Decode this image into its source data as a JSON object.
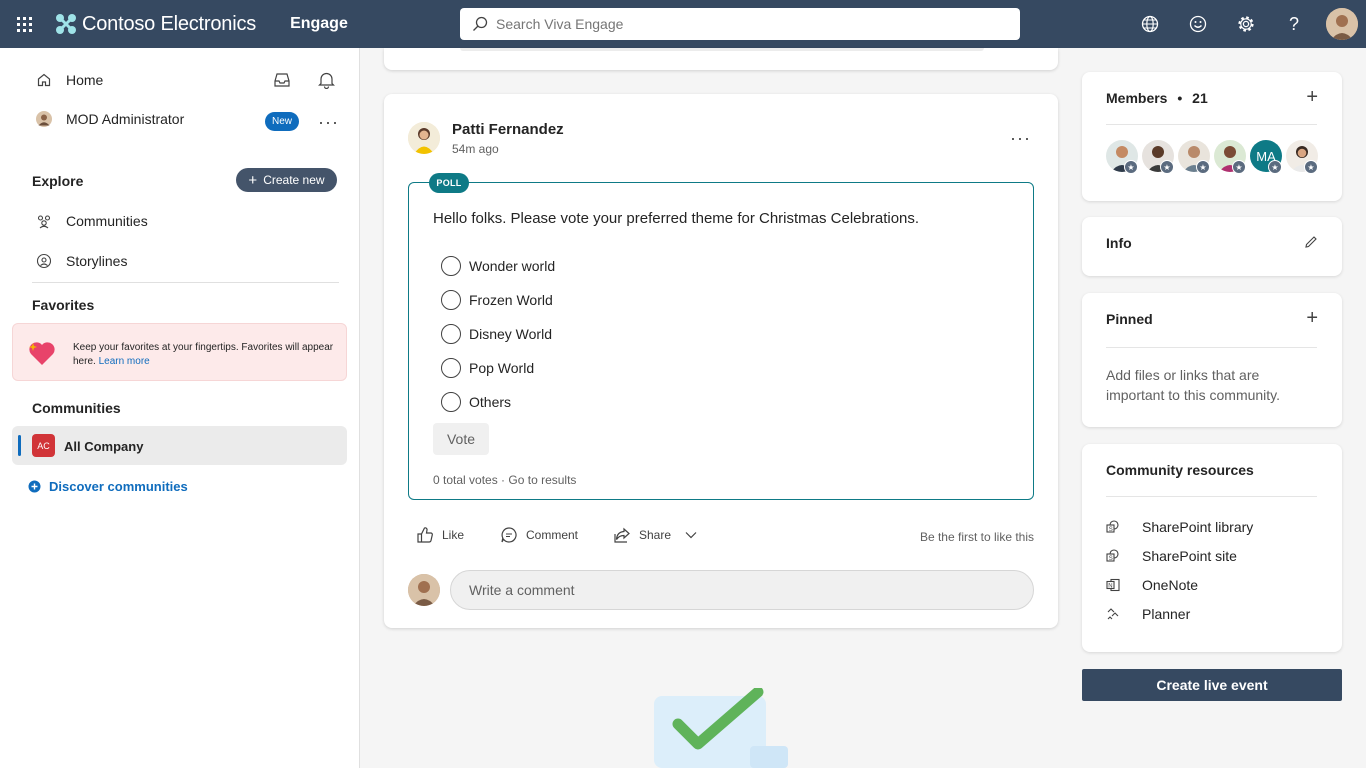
{
  "topbar": {
    "brand": "Contoso Electronics",
    "app": "Engage",
    "search_placeholder": "Search Viva Engage"
  },
  "leftnav": {
    "home": "Home",
    "user": "MOD Administrator",
    "new_badge": "New",
    "explore_title": "Explore",
    "create_new": "Create new",
    "communities": "Communities",
    "storylines": "Storylines",
    "favorites_title": "Favorites",
    "favorites_text": "Keep your favorites at your fingertips. Favorites will appear here.",
    "learn_more": "Learn more",
    "communities_title": "Communities",
    "community_initials": "AC",
    "community_name": "All Company",
    "discover": "Discover communities"
  },
  "post": {
    "author": "Patti Fernandez",
    "time": "54m ago",
    "poll_tag": "POLL",
    "question": "Hello folks. Please vote your preferred theme for Christmas Celebrations.",
    "options": [
      "Wonder world",
      "Frozen World",
      "Disney World",
      "Pop World",
      "Others"
    ],
    "vote": "Vote",
    "total_votes": "0 total votes",
    "separator": " · ",
    "go_results": "Go to results",
    "like": "Like",
    "comment": "Comment",
    "share": "Share",
    "first_like": "Be the first to like this",
    "comment_placeholder": "Write a comment"
  },
  "rail": {
    "members_title": "Members",
    "members_count": "21",
    "member_initials": "MA",
    "info_title": "Info",
    "pinned_title": "Pinned",
    "pinned_text": "Add files or links that are important to this community.",
    "resources_title": "Community resources",
    "resources": [
      "SharePoint library",
      "SharePoint site",
      "OneNote",
      "Planner"
    ],
    "live_event": "Create live event"
  },
  "colors": {
    "topbar": "#364961",
    "accent": "#0f6cbd",
    "poll": "#0e7a86",
    "community_badge": "#d13438"
  }
}
